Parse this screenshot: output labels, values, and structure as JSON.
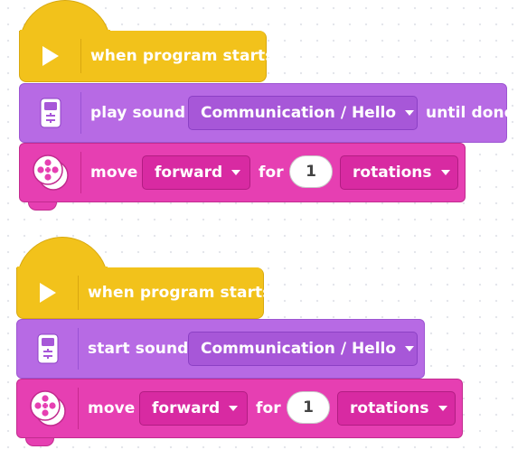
{
  "stacks": [
    {
      "hat": {
        "label": "when program starts",
        "play_icon": "play-icon"
      },
      "sound": {
        "icon": "hub-speaker-icon",
        "label": "play sound",
        "sound_value": "Communication / Hello",
        "suffix": "until done"
      },
      "move": {
        "icon": "motor-pair-icon",
        "label": "move",
        "direction": "forward",
        "for_label": "for",
        "amount": "1",
        "unit": "rotations"
      }
    },
    {
      "hat": {
        "label": "when program starts",
        "play_icon": "play-icon"
      },
      "sound": {
        "icon": "hub-speaker-icon",
        "label": "start sound",
        "sound_value": "Communication / Hello"
      },
      "move": {
        "icon": "motor-pair-icon",
        "label": "move",
        "direction": "forward",
        "for_label": "for",
        "amount": "1",
        "unit": "rotations"
      }
    }
  ],
  "colors": {
    "events": "#f2c21b",
    "sound": "#b76ae4",
    "movement": "#e63fb2",
    "canvas": "#ffffff"
  }
}
